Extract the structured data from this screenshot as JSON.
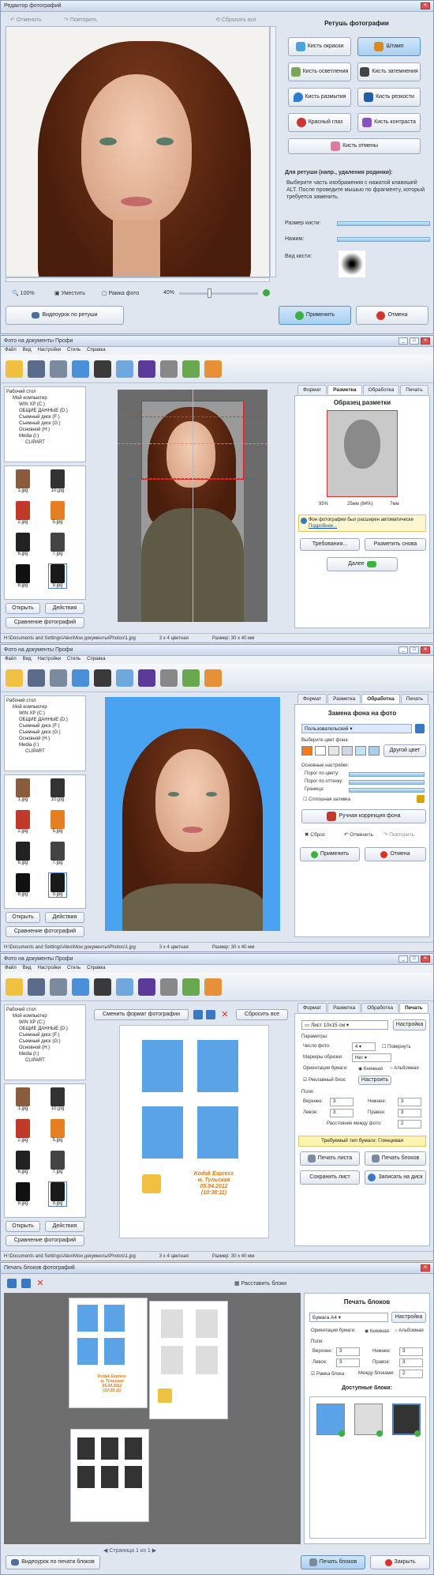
{
  "w1": {
    "title": "Редактор фотографий",
    "undo": "Отменить",
    "redo": "Повторить",
    "reset": "Сбросить все",
    "zoom100": "100%",
    "fit": "Уместить",
    "frame": "Рамка фото",
    "zoomPct": "40%",
    "panelTitle": "Ретушь фотографии",
    "tools": [
      "Кисть окраски",
      "Штамп",
      "Кисть осветления",
      "Кисть затемнения",
      "Кисть размытия",
      "Кисть резкости",
      "Красный глаз",
      "Кисть контраста"
    ],
    "cancelBrush": "Кисть отмены",
    "infoTitle": "Для ретуши (напр., удаления родинки):",
    "infoText": "Выберите часть изображения с нажатой клавишей ALT. После проведите мышью по фрагменту, который требуется заменить.",
    "brushSize": "Размер кисти:",
    "pressure": "Нажим:",
    "brushView": "Вид кисти:",
    "video": "Видеоурок по ретуши",
    "apply": "Применить",
    "cancel": "Отмена"
  },
  "app": {
    "title": "Фото на документы Профи",
    "menu": [
      "Файл",
      "Вид",
      "Настройки",
      "Стиль",
      "Справка"
    ],
    "tree": [
      "Рабочий стол",
      "Мой компьютер",
      "WIN XP (C:)",
      "ОБЩИЕ ДАННЫЕ (D:)",
      "Съемный диск (F:)",
      "Съемный диск (G:)",
      "Основной (H:)",
      "Media (I:)",
      "CLIPART"
    ],
    "thumbs": [
      "1.jpg",
      "10.jpg",
      "2.jpg",
      "5.jpg",
      "6.jpg",
      "7.jpg",
      "8.jpg",
      "9.jpg"
    ],
    "open": "Открыть",
    "actions": "Действия",
    "compare": "Сравнение фотографий",
    "tabs": [
      "Формат",
      "Разметка",
      "Обработка",
      "Печать"
    ],
    "statusPath": "H:\\Documents and Settings\\Alex\\Мои документы\\Photos\\1.jpg",
    "statusFmt": "3 х 4 цветная",
    "statusSize": "Размер: 30 x 40 мм"
  },
  "w2": {
    "sampleTitle": "Образец разметки",
    "labels": [
      "95%",
      "25мм (84%)",
      "7мм"
    ],
    "note": "Фон фотографии был расширен автоматически",
    "more": "Подробнее...",
    "req": "Требования...",
    "remark": "Разметить снова",
    "next": "Далее"
  },
  "w3": {
    "title": "Замена фона на фото",
    "preset": "Пользовательский",
    "pickColor": "Выберите цвет фона:",
    "other": "Другой цвет",
    "basic": "Основные настройки:",
    "p1": "Порог по цвету:",
    "p2": "Порог по оттенку:",
    "p3": "Граница:",
    "solid": "Сплошная заливка",
    "manual": "Ручная коррекция фона",
    "reset": "Сброс",
    "undo": "Отменить",
    "redo": "Повторить",
    "apply": "Применить",
    "cancel": "Отмена",
    "swatches": [
      "#f07c1a",
      "#ffffff",
      "#e6e6e6",
      "#cfd8e2",
      "#bfe3f3",
      "#a9d1ef"
    ]
  },
  "w4": {
    "changeFmt": "Сменить формат фотографии",
    "resetAll": "Сбросить все",
    "paper": "Лист 10x15 см",
    "setup": "Настройка",
    "params": "Параметры:",
    "count": "Число фото:",
    "countVal": "4",
    "rotate": "Повернуть",
    "marks": "Маркеры обрезки:",
    "marksVal": "Нет",
    "orient": "Ориентация бумаги:",
    "book": "Книжная",
    "album": "Альбомная",
    "adBlock": "Рекламный блок:",
    "adSetup": "Настроить",
    "fields": "Поля:",
    "top": "Верхнее:",
    "bottom": "Нижнее:",
    "left": "Левое:",
    "right": "Правое:",
    "between": "Расстояние между фото:",
    "v3": "3",
    "v2": "2",
    "paperType": "Требуемый тип бумаги: Глянцевая",
    "printSheet": "Печать листа",
    "printBlocks": "Печать блоков",
    "save": "Сохранить лист",
    "write": "Записать на диск",
    "ad": [
      "Kodak Express",
      "м. Тульская",
      "05.04.2012",
      "(10:38:11)"
    ]
  },
  "w5": {
    "title": "Печать блоков фотографий",
    "arrange": "Расставить блоки",
    "hdr": "Печать блоков",
    "paper": "Бумага A4",
    "setup": "Настройка",
    "orient": "Ориентация бумаги:",
    "book": "Книжная",
    "album": "Альбомная",
    "fields": "Поля:",
    "top": "Верхнее:",
    "bottom": "Нижнее:",
    "left": "Левое:",
    "right": "Правое:",
    "frame": "Рамка блока",
    "between": "Между блоками:",
    "v3": "3",
    "v2": "2",
    "avail": "Доступные блоки:",
    "page": "Страница 1 из 1",
    "video": "Видеоурок по печати блоков",
    "print": "Печать блоков",
    "close": "Закрыть",
    "ad": [
      "Kodak Express",
      "м. Тульская",
      "05.04.2012",
      "(10:38:11)"
    ]
  }
}
